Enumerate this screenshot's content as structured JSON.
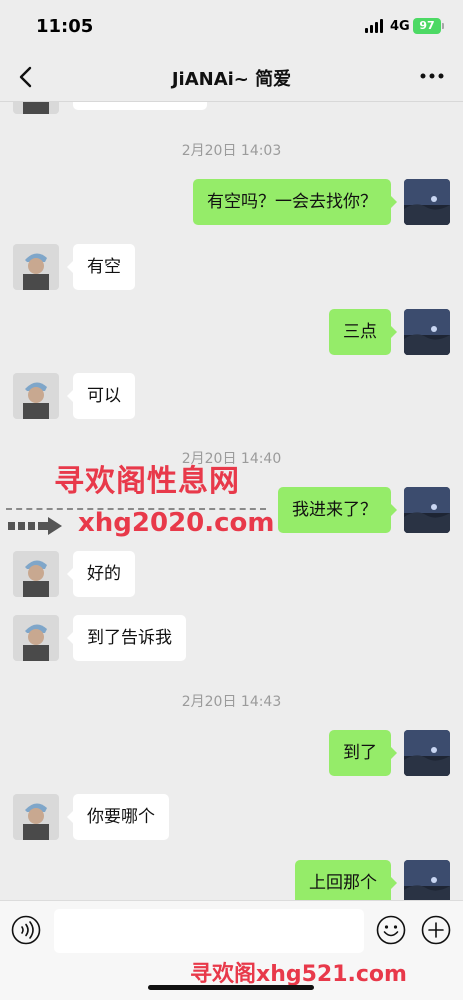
{
  "status_bar": {
    "time": "11:05",
    "network": "4G",
    "battery": "97"
  },
  "nav": {
    "title": "JiANAi~ 简爱",
    "back_icon": "chevron-left-icon",
    "more_icon": "more-dots-icon"
  },
  "chat": {
    "timestamps": [
      "2月20日 14:03",
      "2月20日 14:40",
      "2月20日 14:43"
    ],
    "messages": [
      {
        "side": "right",
        "text": "有空吗？一会去找你？"
      },
      {
        "side": "left",
        "text": "有空"
      },
      {
        "side": "right",
        "text": "三点"
      },
      {
        "side": "left",
        "text": "可以"
      },
      {
        "side": "right",
        "text": "我进来了？"
      },
      {
        "side": "left",
        "text": "好的"
      },
      {
        "side": "left",
        "text": "到了告诉我"
      },
      {
        "side": "right",
        "text": "到了"
      },
      {
        "side": "left",
        "text": "你要哪个"
      },
      {
        "side": "right",
        "text": "上回那个"
      }
    ]
  },
  "watermarks": {
    "title": "寻欢阁性息网",
    "url": "xhg2020.com",
    "bottom": "寻欢阁xhg521.com"
  },
  "input_bar": {
    "placeholder": "",
    "voice_icon": "voice-icon",
    "emoji_icon": "emoji-icon",
    "plus_icon": "plus-icon"
  },
  "colors": {
    "sent_bubble": "#95ec69",
    "received_bubble": "#ffffff",
    "background": "#ededed",
    "watermark": "#e8394a"
  }
}
